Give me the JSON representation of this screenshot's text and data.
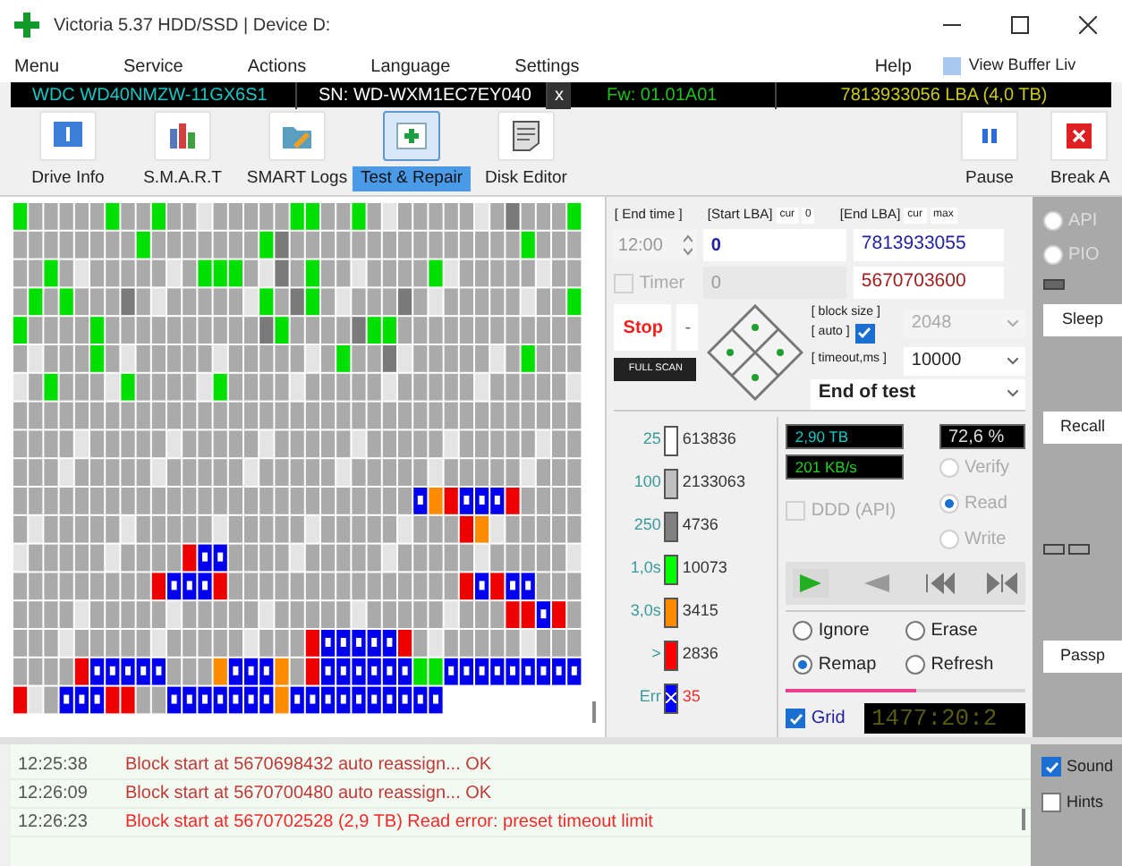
{
  "window": {
    "title": "Victoria 5.37 HDD/SSD | Device D:"
  },
  "menu": [
    "Menu",
    "Service",
    "Actions",
    "Language",
    "Settings",
    "Help"
  ],
  "view_buffer": {
    "label": "View Buffer Liv",
    "checked": false
  },
  "drive_bar": {
    "model": "WDC WD40NMZW-11GX6S1",
    "serial": "SN: WD-WXM1EC7EY040",
    "close": "x",
    "firmware": "Fw: 01.01A01",
    "capacity": "7813933056 LBA (4,0 TB)"
  },
  "toolbar": [
    {
      "label": "Drive Info",
      "selected": false
    },
    {
      "label": "S.M.A.R.T",
      "selected": false
    },
    {
      "label": "SMART Logs",
      "selected": false
    },
    {
      "label": "Test & Repair",
      "selected": true
    },
    {
      "label": "Disk Editor",
      "selected": false
    }
  ],
  "toolbar_right": [
    {
      "label": "Pause"
    },
    {
      "label": "Break A"
    }
  ],
  "range": {
    "end_time_label": "[ End time ]",
    "start_label": "[Start LBA]",
    "start_cur": "cur",
    "start_zero": "0",
    "end_label": "[End LBA]",
    "end_cur": "cur",
    "end_max": "max",
    "time": "12:00",
    "start_value": "0",
    "end_value": "7813933055",
    "timer": {
      "label": "Timer",
      "checked": false
    },
    "timer_value": "0",
    "current_value": "5670703600"
  },
  "stop_button": "Stop",
  "stop_menu": "-",
  "full_scan": "FULL SCAN",
  "block": {
    "size_label": "[ block size ]",
    "auto_label": "[ auto ]",
    "auto": true,
    "size": "2048",
    "timeout_label": "[ timeout,ms ]",
    "timeout": "10000",
    "end_action": "End of test"
  },
  "legend": [
    {
      "threshold": "25",
      "count": "613836",
      "color": "#ffffff",
      "kind": "time"
    },
    {
      "threshold": "100",
      "count": "2133063",
      "color": "#c0c0c0",
      "kind": "time"
    },
    {
      "threshold": "250",
      "count": "4736",
      "color": "#808080",
      "kind": "time"
    },
    {
      "threshold": "1,0s",
      "count": "10073",
      "color": "#00ff00",
      "kind": "time"
    },
    {
      "threshold": "3,0s",
      "count": "3415",
      "color": "#ff8c00",
      "kind": "time"
    },
    {
      "threshold": ">",
      "count": "2836",
      "color": "#ff0000",
      "kind": "time"
    },
    {
      "threshold": "Err",
      "count": "35",
      "color": "#0000ff",
      "kind": "error"
    }
  ],
  "stats": {
    "position": "2,90 TB",
    "percent": "72,6 %",
    "speed": "201 KB/s"
  },
  "ddd": {
    "label": "DDD (API)",
    "checked": false
  },
  "mode": [
    {
      "label": "Verify",
      "selected": false
    },
    {
      "label": "Read",
      "selected": true
    },
    {
      "label": "Write",
      "selected": false
    }
  ],
  "actions": [
    {
      "label": "Ignore",
      "selected": false
    },
    {
      "label": "Erase",
      "selected": false
    },
    {
      "label": "Remap",
      "selected": true
    },
    {
      "label": "Refresh",
      "selected": false
    }
  ],
  "progress": {
    "level": 0.54
  },
  "grid": {
    "label": "Grid",
    "checked": true
  },
  "elapsed": "1477:20:2",
  "side": {
    "api": {
      "label": "API",
      "selected": false
    },
    "pio": {
      "label": "PIO",
      "selected": false
    },
    "buttons": [
      "Sleep",
      "Recall",
      "Passp"
    ]
  },
  "log": [
    {
      "time": "12:25:38",
      "message": "Block start at 5670698432 auto reassign... OK",
      "kind": "info"
    },
    {
      "time": "12:26:09",
      "message": "Block start at 5670700480 auto reassign... OK",
      "kind": "info"
    },
    {
      "time": "12:26:23",
      "message": "Block start at 5670702528 (2,9 TB) Read error: preset timeout limit",
      "kind": "error"
    }
  ],
  "log_options": [
    {
      "label": "Sound",
      "checked": true
    },
    {
      "label": "Hints",
      "checked": false
    }
  ]
}
